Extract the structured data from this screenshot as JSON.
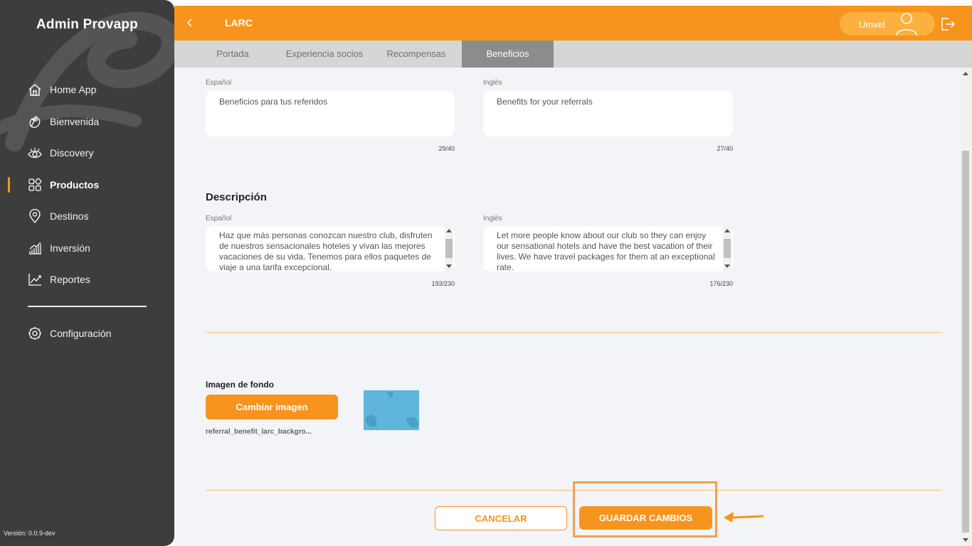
{
  "sidebar": {
    "brand": "Admin Provapp",
    "items": [
      {
        "label": "Home App",
        "icon": "home-icon"
      },
      {
        "label": "Bienvenida",
        "icon": "wave-hand-icon"
      },
      {
        "label": "Discovery",
        "icon": "eye-icon"
      },
      {
        "label": "Productos",
        "icon": "grid-icon",
        "active": true
      },
      {
        "label": "Destinos",
        "icon": "location-pin-icon"
      },
      {
        "label": "Inversión",
        "icon": "bar-chart-icon"
      },
      {
        "label": "Reportes",
        "icon": "line-chart-icon"
      }
    ],
    "config": {
      "label": "Configuración",
      "icon": "gear-icon"
    },
    "version": "Versión: 0.0.9-dev"
  },
  "header": {
    "title": "LARC",
    "user": "Umvel"
  },
  "tabs": [
    {
      "label": "Portada",
      "active": false
    },
    {
      "label": "Experiencia socios",
      "active": false
    },
    {
      "label": "Recompensas",
      "active": false
    },
    {
      "label": "Beneficios",
      "active": true
    }
  ],
  "title_section": {
    "es_label": "Español",
    "es_value": "Beneficios para tus referidos",
    "es_counter": "29/40",
    "en_label": "Inglés",
    "en_value": "Benefits for your referrals",
    "en_counter": "27/40"
  },
  "description_section": {
    "title": "Descripción",
    "es_label": "Español",
    "es_value": "Haz que más personas conozcan nuestro club, disfruten de nuestros sensacionales hoteles y vivan las mejores vacaciones de su vida. Tenemos para ellos paquetes de viaje a una tarifa excepcional.",
    "es_counter": "193/230",
    "en_label": "Inglés",
    "en_value": "Let more people know about our club so they can enjoy our sensational hotels and have the best vacation of their lives. We have travel packages for them at an exceptional rate.",
    "en_counter": "176/230"
  },
  "background_image": {
    "label": "Imagen de fondo",
    "button": "Cambiar imagen",
    "filename": "referral_benefit_larc_backgro..."
  },
  "actions": {
    "cancel": "CANCELAR",
    "save": "GUARDAR CAMBIOS"
  },
  "colors": {
    "accent": "#f7941d",
    "sidebar": "#3d3d3d",
    "content_bg": "#f3f4f8",
    "tab_active": "#8c8c8c"
  }
}
